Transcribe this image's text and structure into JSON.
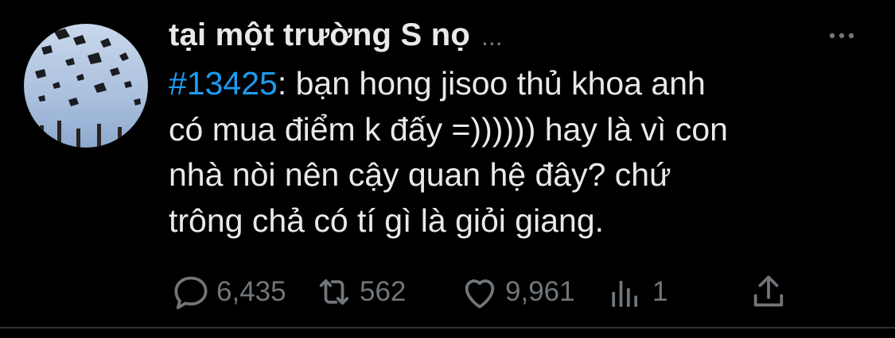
{
  "tweet": {
    "display_name": "tại một trường S nọ",
    "name_ellipsis": "...",
    "hashtag": "#13425",
    "body": ": bạn hong jisoo thủ khoa anh có mua điểm k đấy =)))))) hay là vì con nhà nòi nên cậy quan hệ đây? chứ trông chả có tí gì là giỏi giang.",
    "lines": [
      "bạn hong jisoo thủ khoa anh",
      "có mua điểm k đấy =)))))) hay là vì con",
      "nhà nòi nên cậy quan hệ đây? chứ",
      "trông chả có tí gì là giỏi giang."
    ]
  },
  "actions": {
    "reply_count": "6,435",
    "retweet_count": "562",
    "like_count": "9,961",
    "views_count": "1"
  },
  "icons": {
    "avatar": "graduation-caps-sky-avatar",
    "more": "more-horizontal-icon",
    "reply": "reply-icon",
    "retweet": "retweet-icon",
    "like": "heart-icon",
    "views": "analytics-icon",
    "share": "share-icon"
  },
  "colors": {
    "background": "#000000",
    "text": "#e7e9ea",
    "muted": "#71767b",
    "link": "#1d9bf0",
    "divider": "#2f3336"
  }
}
